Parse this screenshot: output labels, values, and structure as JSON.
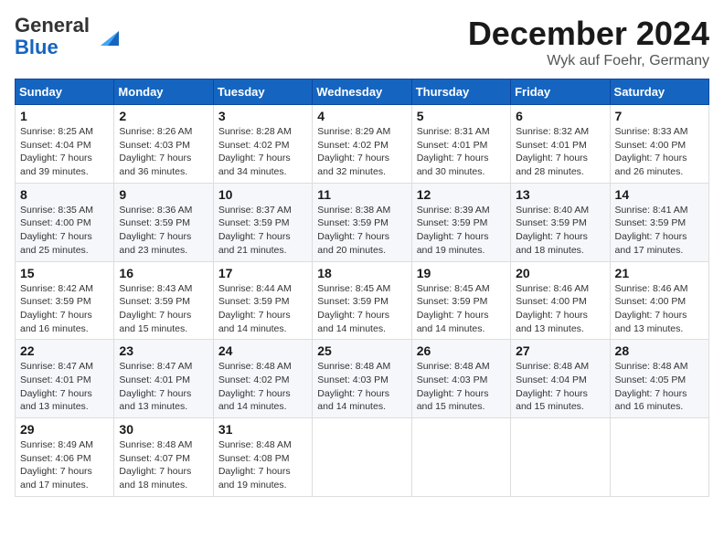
{
  "header": {
    "logo_general": "General",
    "logo_blue": "Blue",
    "month": "December 2024",
    "location": "Wyk auf Foehr, Germany"
  },
  "days_of_week": [
    "Sunday",
    "Monday",
    "Tuesday",
    "Wednesday",
    "Thursday",
    "Friday",
    "Saturday"
  ],
  "weeks": [
    [
      {
        "day": "1",
        "sunrise": "8:25 AM",
        "sunset": "4:04 PM",
        "daylight": "7 hours and 39 minutes."
      },
      {
        "day": "2",
        "sunrise": "8:26 AM",
        "sunset": "4:03 PM",
        "daylight": "7 hours and 36 minutes."
      },
      {
        "day": "3",
        "sunrise": "8:28 AM",
        "sunset": "4:02 PM",
        "daylight": "7 hours and 34 minutes."
      },
      {
        "day": "4",
        "sunrise": "8:29 AM",
        "sunset": "4:02 PM",
        "daylight": "7 hours and 32 minutes."
      },
      {
        "day": "5",
        "sunrise": "8:31 AM",
        "sunset": "4:01 PM",
        "daylight": "7 hours and 30 minutes."
      },
      {
        "day": "6",
        "sunrise": "8:32 AM",
        "sunset": "4:01 PM",
        "daylight": "7 hours and 28 minutes."
      },
      {
        "day": "7",
        "sunrise": "8:33 AM",
        "sunset": "4:00 PM",
        "daylight": "7 hours and 26 minutes."
      }
    ],
    [
      {
        "day": "8",
        "sunrise": "8:35 AM",
        "sunset": "4:00 PM",
        "daylight": "7 hours and 25 minutes."
      },
      {
        "day": "9",
        "sunrise": "8:36 AM",
        "sunset": "3:59 PM",
        "daylight": "7 hours and 23 minutes."
      },
      {
        "day": "10",
        "sunrise": "8:37 AM",
        "sunset": "3:59 PM",
        "daylight": "7 hours and 21 minutes."
      },
      {
        "day": "11",
        "sunrise": "8:38 AM",
        "sunset": "3:59 PM",
        "daylight": "7 hours and 20 minutes."
      },
      {
        "day": "12",
        "sunrise": "8:39 AM",
        "sunset": "3:59 PM",
        "daylight": "7 hours and 19 minutes."
      },
      {
        "day": "13",
        "sunrise": "8:40 AM",
        "sunset": "3:59 PM",
        "daylight": "7 hours and 18 minutes."
      },
      {
        "day": "14",
        "sunrise": "8:41 AM",
        "sunset": "3:59 PM",
        "daylight": "7 hours and 17 minutes."
      }
    ],
    [
      {
        "day": "15",
        "sunrise": "8:42 AM",
        "sunset": "3:59 PM",
        "daylight": "7 hours and 16 minutes."
      },
      {
        "day": "16",
        "sunrise": "8:43 AM",
        "sunset": "3:59 PM",
        "daylight": "7 hours and 15 minutes."
      },
      {
        "day": "17",
        "sunrise": "8:44 AM",
        "sunset": "3:59 PM",
        "daylight": "7 hours and 14 minutes."
      },
      {
        "day": "18",
        "sunrise": "8:45 AM",
        "sunset": "3:59 PM",
        "daylight": "7 hours and 14 minutes."
      },
      {
        "day": "19",
        "sunrise": "8:45 AM",
        "sunset": "3:59 PM",
        "daylight": "7 hours and 14 minutes."
      },
      {
        "day": "20",
        "sunrise": "8:46 AM",
        "sunset": "4:00 PM",
        "daylight": "7 hours and 13 minutes."
      },
      {
        "day": "21",
        "sunrise": "8:46 AM",
        "sunset": "4:00 PM",
        "daylight": "7 hours and 13 minutes."
      }
    ],
    [
      {
        "day": "22",
        "sunrise": "8:47 AM",
        "sunset": "4:01 PM",
        "daylight": "7 hours and 13 minutes."
      },
      {
        "day": "23",
        "sunrise": "8:47 AM",
        "sunset": "4:01 PM",
        "daylight": "7 hours and 13 minutes."
      },
      {
        "day": "24",
        "sunrise": "8:48 AM",
        "sunset": "4:02 PM",
        "daylight": "7 hours and 14 minutes."
      },
      {
        "day": "25",
        "sunrise": "8:48 AM",
        "sunset": "4:03 PM",
        "daylight": "7 hours and 14 minutes."
      },
      {
        "day": "26",
        "sunrise": "8:48 AM",
        "sunset": "4:03 PM",
        "daylight": "7 hours and 15 minutes."
      },
      {
        "day": "27",
        "sunrise": "8:48 AM",
        "sunset": "4:04 PM",
        "daylight": "7 hours and 15 minutes."
      },
      {
        "day": "28",
        "sunrise": "8:48 AM",
        "sunset": "4:05 PM",
        "daylight": "7 hours and 16 minutes."
      }
    ],
    [
      {
        "day": "29",
        "sunrise": "8:49 AM",
        "sunset": "4:06 PM",
        "daylight": "7 hours and 17 minutes."
      },
      {
        "day": "30",
        "sunrise": "8:48 AM",
        "sunset": "4:07 PM",
        "daylight": "7 hours and 18 minutes."
      },
      {
        "day": "31",
        "sunrise": "8:48 AM",
        "sunset": "4:08 PM",
        "daylight": "7 hours and 19 minutes."
      },
      null,
      null,
      null,
      null
    ]
  ]
}
